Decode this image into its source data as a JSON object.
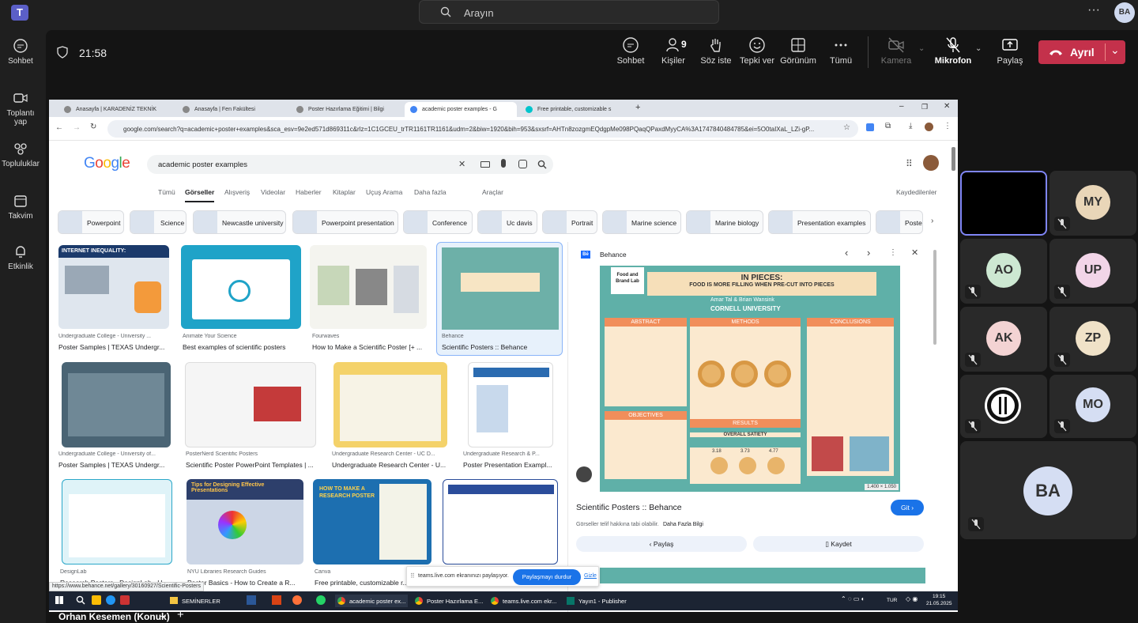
{
  "teams": {
    "search_placeholder": "Arayın",
    "user_initials": "BA",
    "rail": [
      {
        "label": "Sohbet",
        "icon": "chat-icon"
      },
      {
        "label": "Toplantı yap",
        "icon": "video-icon"
      },
      {
        "label": "Topluluklar",
        "icon": "community-icon"
      },
      {
        "label": "Takvim",
        "icon": "calendar-icon"
      },
      {
        "label": "Etkinlik",
        "icon": "bell-icon"
      }
    ],
    "meeting": {
      "timer": "21:58",
      "chat": "Sohbet",
      "people": "Kişiler",
      "people_count": "9",
      "raise_hand": "Söz iste",
      "react": "Tepki ver",
      "view": "Görünüm",
      "more": "Tümü",
      "camera": "Kamera",
      "mic": "Mikrofon",
      "share": "Paylaş",
      "leave": "Ayrıl"
    },
    "participants": [
      {
        "initials": "MY",
        "color": "#e9d6b8"
      },
      {
        "initials": "AO",
        "color": "#cde8d2"
      },
      {
        "initials": "UP",
        "color": "#f2d5e8"
      },
      {
        "initials": "AK",
        "color": "#f3d3d3"
      },
      {
        "initials": "ZP",
        "color": "#f0e2c8"
      },
      {
        "initials": "",
        "color": "#ffffff"
      },
      {
        "initials": "MO",
        "color": "#d5def3"
      },
      {
        "initials": "BA",
        "color": "#d5def3"
      }
    ],
    "sharer_name": "Orhan Kesemen (Konuk)"
  },
  "browser": {
    "tabs": [
      "Anasayfa | KARADENİZ TEKNİK",
      "Anasayfa | Fen Fakültesi",
      "Poster Hazırlama Eğitimi | Bilgi",
      "academic poster examples - G",
      "Free printable, customizable s"
    ],
    "url": "google.com/search?q=academic+poster+examples&sca_esv=9e2ed571d869311c&rlz=1C1GCEU_trTR1161TR1161&udm=2&biw=1920&bih=953&sxsrf=AHTn8zozgmEQdgpMe098PQaqQPaxdMyyCA%3A1747840484785&ei=5O0taIXaL_LZi-gP...",
    "status_url": "https://www.behance.net/gallery/30160927/Scientific-Posters"
  },
  "google": {
    "logo": "Google",
    "query": "academic poster examples",
    "tabs": [
      "Tümü",
      "Görseller",
      "Alışveriş",
      "Videolar",
      "Haberler",
      "Kitaplar",
      "Uçuş Arama",
      "Daha fazla",
      "Araçlar"
    ],
    "saved": "Kaydedilenler",
    "chips": [
      "Powerpoint",
      "Science",
      "Newcastle university",
      "Powerpoint presentation",
      "Conference",
      "Uc davis",
      "Portrait",
      "Marine science",
      "Marine biology",
      "Presentation examples",
      "Poster"
    ],
    "results": [
      {
        "source": "Undergraduate College - University ...",
        "title": "Poster Samples | TEXAS Undergr..."
      },
      {
        "source": "Animate Your Science",
        "title": "Best examples of scientific posters"
      },
      {
        "source": "Fourwaves",
        "title": "How to Make a Scientific Poster [+ ..."
      },
      {
        "source": "Behance",
        "title": "Scientific Posters :: Behance"
      },
      {
        "source": "Undergraduate College - University of...",
        "title": "Poster Samples | TEXAS Undergr..."
      },
      {
        "source": "PosterNerd Scientific Posters",
        "title": "Scientific Poster PowerPoint Templates | ..."
      },
      {
        "source": "Undergraduate Research Center - UC D...",
        "title": "Undergraduate Research Center - U..."
      },
      {
        "source": "Undergraduate Research & P...",
        "title": "Poster Presentation Exampl..."
      },
      {
        "source": "DesignLab",
        "title": "Research Posters - DesignLab - U..."
      },
      {
        "source": "NYU Libraries Research Guides",
        "title": "Poster Basics - How to Create a R..."
      },
      {
        "source": "Canva",
        "title": "Free printable, customizable r..."
      },
      {
        "source": "",
        "title": ""
      }
    ],
    "thumb_texts": [
      "INTERNET INEQUALITY:",
      "Tips for Designing Effective Presentations",
      "HOW TO MAKE A RESEARCH POSTER"
    ],
    "preview": {
      "source": "Behance",
      "title": "Scientific Posters :: Behance",
      "visit": "Git",
      "license_note": "Görseller telif hakkına tabi olabilir.",
      "more_info": "Daha Fazla Bilgi",
      "share": "Paylaş",
      "save": "Kaydet",
      "size": "1.400 × 1.050",
      "poster": {
        "lab": "Food and Brand Lab",
        "heading": "IN PIECES:",
        "subheading": "FOOD IS MORE FILLING WHEN PRE-CUT INTO PIECES",
        "authors": "Amar Tal & Brian Wansink",
        "university": "CORNELL UNIVERSITY",
        "abstract": "ABSTRACT",
        "methods": "METHODS",
        "conclusions": "CONCLUSIONS",
        "objectives": "OBJECTIVES",
        "results": "RESULTS",
        "satiety": "OVERALL SATIETY",
        "values": [
          "3.18",
          "3.73",
          "4.77"
        ]
      }
    },
    "share_banner": {
      "text": "teams.live.com ekranınızı paylaşıyor.",
      "stop": "Paylaşmayı durdur",
      "hide": "Gizle"
    }
  },
  "taskbar": {
    "items": [
      "SEMİNERLER",
      "academic poster ex...",
      "Poster Hazırlama E...",
      "teams.live.com ekr...",
      "Yayın1 - Publisher"
    ],
    "lang": "TUR",
    "time": "19:15",
    "date": "21.05.2025"
  }
}
